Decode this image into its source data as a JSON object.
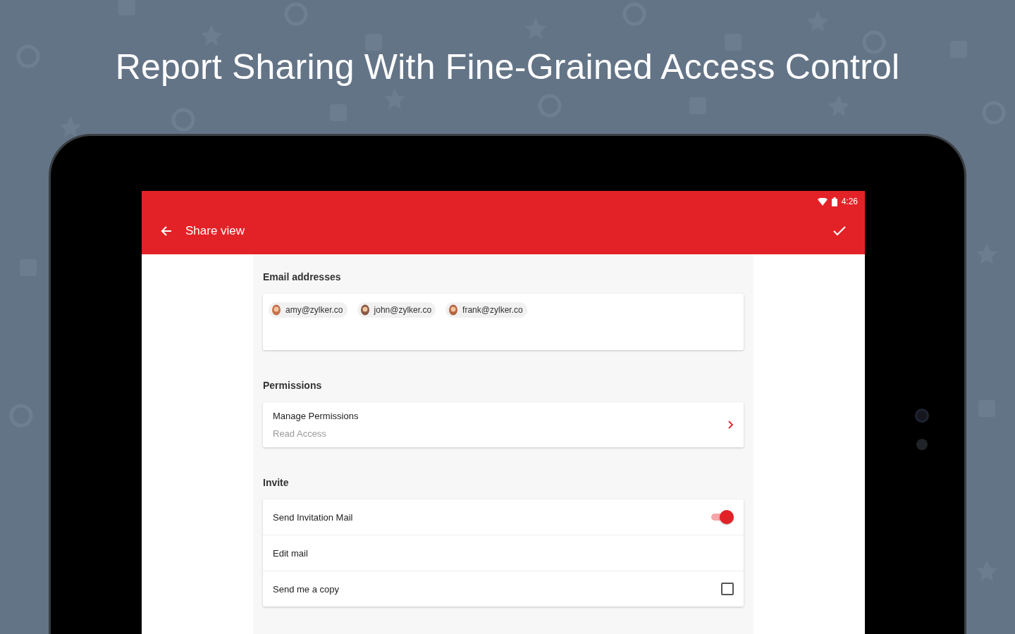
{
  "headline": "Report Sharing With Fine-Grained Access Control",
  "status_bar": {
    "time": "4:26"
  },
  "toolbar": {
    "title": "Share view"
  },
  "email": {
    "label": "Email addresses",
    "recipients": [
      {
        "email": "amy@zylker.co"
      },
      {
        "email": "john@zylker.co"
      },
      {
        "email": "frank@zylker.co"
      }
    ]
  },
  "permissions": {
    "label": "Permissions",
    "title": "Manage Permissions",
    "value": "Read Access"
  },
  "invite": {
    "label": "Invite",
    "rows": [
      {
        "kind": "switch",
        "label": "Send Invitation Mail",
        "on": true
      },
      {
        "kind": "link",
        "label": "Edit mail"
      },
      {
        "kind": "checkbox",
        "label": "Send me a copy",
        "checked": false
      }
    ]
  }
}
